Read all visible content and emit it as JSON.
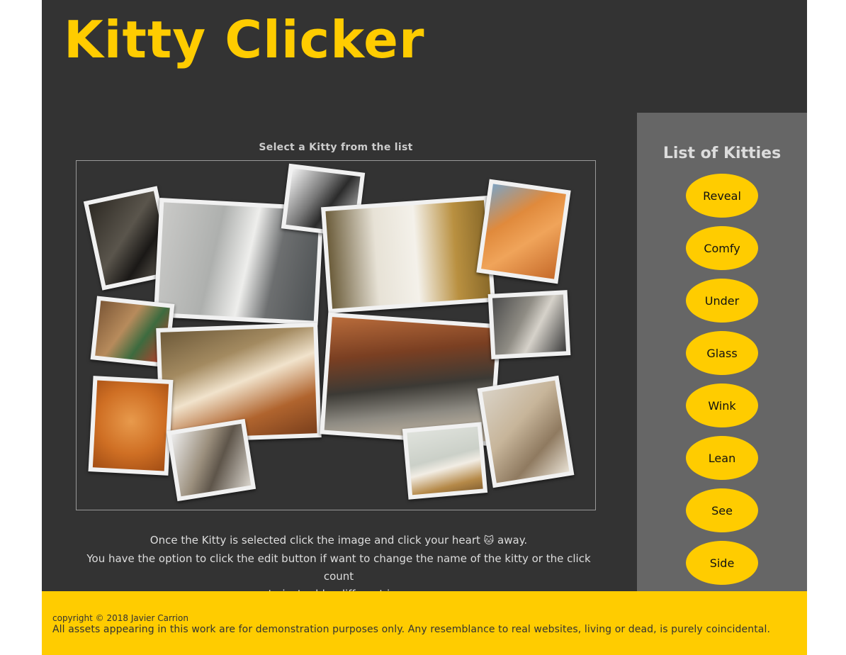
{
  "header": {
    "title": "Kitty Clicker"
  },
  "main": {
    "instruction": "Select a Kitty from the list",
    "help_line1_a": "Once the Kitty is selected click the image and click your heart",
    "help_line1_icon": "🐱",
    "help_line1_b": "away.",
    "help_line2": "You have the option to click the edit button if want to change the name of the kitty or the click count",
    "help_line3": "or to just add a different image."
  },
  "sidebar": {
    "title": "List of Kitties",
    "items": [
      {
        "label": "Reveal"
      },
      {
        "label": "Comfy"
      },
      {
        "label": "Under"
      },
      {
        "label": "Glass"
      },
      {
        "label": "Wink"
      },
      {
        "label": "Lean"
      },
      {
        "label": "See"
      },
      {
        "label": "Side"
      }
    ]
  },
  "footer": {
    "copyright": "copyright © 2018 Javier Carrion",
    "disclaimer": "All assets appearing in this work are for demonstration purposes only. Any resemblance to real websites, living or dead, is purely coincidental."
  },
  "colors": {
    "accent": "#ffcc00",
    "background": "#333333",
    "sidebar": "#666666"
  }
}
